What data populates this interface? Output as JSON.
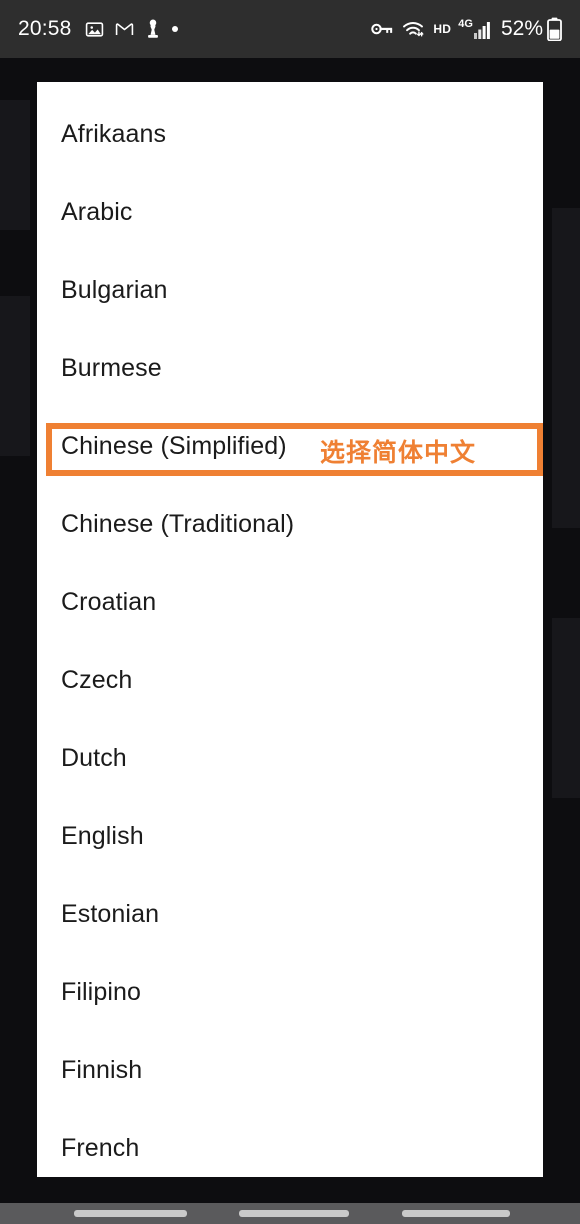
{
  "status_bar": {
    "time": "20:58",
    "left_icons": [
      {
        "name": "photos-icon",
        "glyph": "image"
      },
      {
        "name": "gmail-icon",
        "glyph": "M"
      },
      {
        "name": "chess-pawn-icon",
        "glyph": "pawn"
      },
      {
        "name": "notification-dot-icon",
        "glyph": "dot"
      }
    ],
    "right_icons": [
      {
        "name": "vpn-key-icon",
        "glyph": "key"
      },
      {
        "name": "wifi-icon",
        "glyph": "wifi"
      }
    ],
    "hd_label": "HD",
    "network_label": "4G",
    "battery_percent": "52%",
    "background_color": "#2e2e2e"
  },
  "dialog": {
    "name": "language-selection-dialog",
    "background_color": "#ffffff",
    "languages": [
      {
        "label": "Afrikaans",
        "selected": false
      },
      {
        "label": "Arabic",
        "selected": false
      },
      {
        "label": "Bulgarian",
        "selected": false
      },
      {
        "label": "Burmese",
        "selected": false
      },
      {
        "label": "Chinese (Simplified)",
        "selected": true
      },
      {
        "label": "Chinese (Traditional)",
        "selected": false
      },
      {
        "label": "Croatian",
        "selected": false
      },
      {
        "label": "Czech",
        "selected": false
      },
      {
        "label": "Dutch",
        "selected": false
      },
      {
        "label": "English",
        "selected": false
      },
      {
        "label": "Estonian",
        "selected": false
      },
      {
        "label": "Filipino",
        "selected": false
      },
      {
        "label": "Finnish",
        "selected": false
      },
      {
        "label": "French",
        "selected": false
      }
    ]
  },
  "annotation": {
    "text": "选择简体中文",
    "color": "#ef8033",
    "target_label": "Chinese (Simplified)"
  },
  "nav_bar": {
    "background_color": "#5a5a5c",
    "hint_color": "#c9c9c9"
  }
}
